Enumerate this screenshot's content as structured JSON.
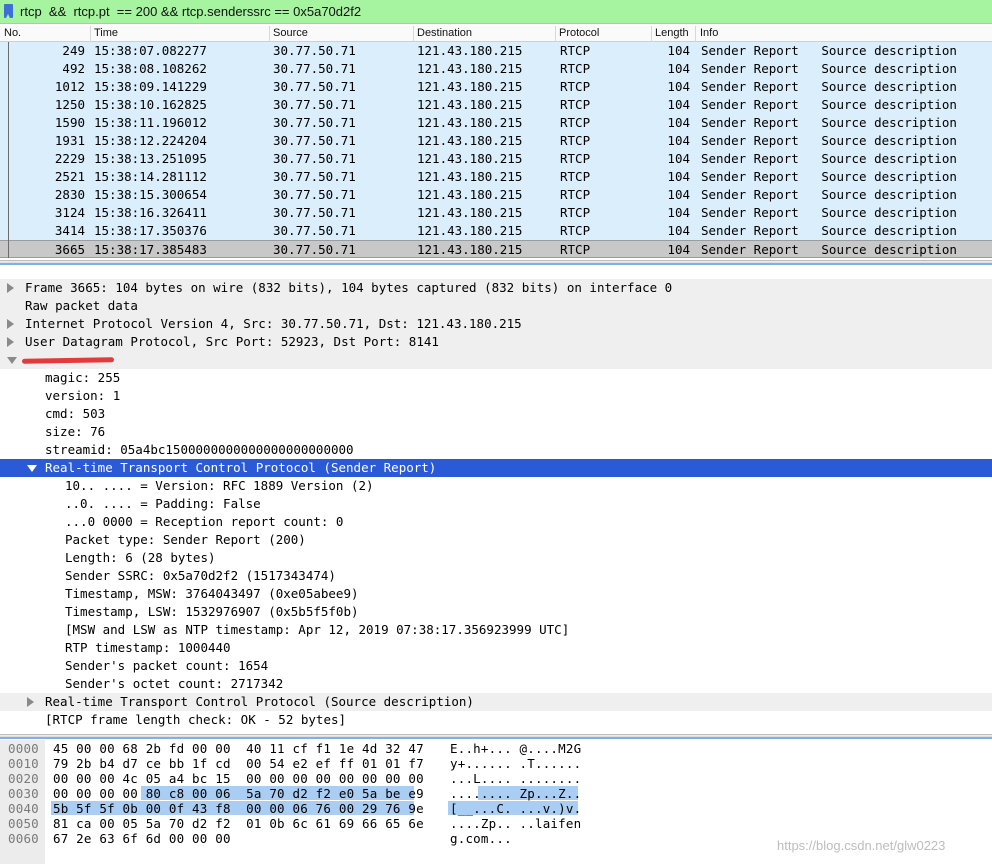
{
  "filter": {
    "value": "rtcp  &&  rtcp.pt  == 200 && rtcp.senderssrc == 0x5a70d2f2"
  },
  "packet_list": {
    "columns": [
      "No.",
      "Time",
      "Source",
      "Destination",
      "Protocol",
      "Length",
      "Info"
    ],
    "rows": [
      {
        "no": "249",
        "time": "15:38:07.082277",
        "src": "30.77.50.71",
        "dst": "121.43.180.215",
        "proto": "RTCP",
        "len": "104",
        "info": "Sender Report   Source description"
      },
      {
        "no": "492",
        "time": "15:38:08.108262",
        "src": "30.77.50.71",
        "dst": "121.43.180.215",
        "proto": "RTCP",
        "len": "104",
        "info": "Sender Report   Source description"
      },
      {
        "no": "1012",
        "time": "15:38:09.141229",
        "src": "30.77.50.71",
        "dst": "121.43.180.215",
        "proto": "RTCP",
        "len": "104",
        "info": "Sender Report   Source description"
      },
      {
        "no": "1250",
        "time": "15:38:10.162825",
        "src": "30.77.50.71",
        "dst": "121.43.180.215",
        "proto": "RTCP",
        "len": "104",
        "info": "Sender Report   Source description"
      },
      {
        "no": "1590",
        "time": "15:38:11.196012",
        "src": "30.77.50.71",
        "dst": "121.43.180.215",
        "proto": "RTCP",
        "len": "104",
        "info": "Sender Report   Source description"
      },
      {
        "no": "1931",
        "time": "15:38:12.224204",
        "src": "30.77.50.71",
        "dst": "121.43.180.215",
        "proto": "RTCP",
        "len": "104",
        "info": "Sender Report   Source description"
      },
      {
        "no": "2229",
        "time": "15:38:13.251095",
        "src": "30.77.50.71",
        "dst": "121.43.180.215",
        "proto": "RTCP",
        "len": "104",
        "info": "Sender Report   Source description"
      },
      {
        "no": "2521",
        "time": "15:38:14.281112",
        "src": "30.77.50.71",
        "dst": "121.43.180.215",
        "proto": "RTCP",
        "len": "104",
        "info": "Sender Report   Source description"
      },
      {
        "no": "2830",
        "time": "15:38:15.300654",
        "src": "30.77.50.71",
        "dst": "121.43.180.215",
        "proto": "RTCP",
        "len": "104",
        "info": "Sender Report   Source description"
      },
      {
        "no": "3124",
        "time": "15:38:16.326411",
        "src": "30.77.50.71",
        "dst": "121.43.180.215",
        "proto": "RTCP",
        "len": "104",
        "info": "Sender Report   Source description"
      },
      {
        "no": "3414",
        "time": "15:38:17.350376",
        "src": "30.77.50.71",
        "dst": "121.43.180.215",
        "proto": "RTCP",
        "len": "104",
        "info": "Sender Report   Source description"
      },
      {
        "no": "3665",
        "time": "15:38:17.385483",
        "src": "30.77.50.71",
        "dst": "121.43.180.215",
        "proto": "RTCP",
        "len": "104",
        "info": "Sender Report   Source description"
      }
    ],
    "selected_no": "3665"
  },
  "details": [
    {
      "text": "Frame 3665: 104 bytes on wire (832 bits), 104 bytes captured (832 bits) on interface 0",
      "level": 0,
      "arrow": "right",
      "band": true
    },
    {
      "text": "Raw packet data",
      "level": 0,
      "arrow": "none",
      "band": true
    },
    {
      "text": "Internet Protocol Version 4, Src: 30.77.50.71, Dst: 121.43.180.215",
      "level": 0,
      "arrow": "right",
      "band": true
    },
    {
      "text": "User Datagram Protocol, Src Port: 52923, Dst Port: 8141",
      "level": 0,
      "arrow": "right",
      "band": true
    },
    {
      "text": "",
      "level": 0,
      "arrow": "down",
      "band": true,
      "redacted": true
    },
    {
      "text": "magic: 255",
      "level": 1,
      "arrow": "none"
    },
    {
      "text": "version: 1",
      "level": 1,
      "arrow": "none"
    },
    {
      "text": "cmd: 503",
      "level": 1,
      "arrow": "none"
    },
    {
      "text": "size: 76",
      "level": 1,
      "arrow": "none"
    },
    {
      "text": "streamid: 05a4bc1500000000000000000000000",
      "level": 1,
      "arrow": "none"
    },
    {
      "text": "Real-time Transport Control Protocol (Sender Report)",
      "level": 1,
      "arrow": "down",
      "selected": true
    },
    {
      "text": "10.. .... = Version: RFC 1889 Version (2)",
      "level": 2,
      "arrow": "none"
    },
    {
      "text": "..0. .... = Padding: False",
      "level": 2,
      "arrow": "none"
    },
    {
      "text": "...0 0000 = Reception report count: 0",
      "level": 2,
      "arrow": "none"
    },
    {
      "text": "Packet type: Sender Report (200)",
      "level": 2,
      "arrow": "none"
    },
    {
      "text": "Length: 6 (28 bytes)",
      "level": 2,
      "arrow": "none"
    },
    {
      "text": "Sender SSRC: 0x5a70d2f2 (1517343474)",
      "level": 2,
      "arrow": "none"
    },
    {
      "text": "Timestamp, MSW: 3764043497 (0xe05abee9)",
      "level": 2,
      "arrow": "none"
    },
    {
      "text": "Timestamp, LSW: 1532976907 (0x5b5f5f0b)",
      "level": 2,
      "arrow": "none"
    },
    {
      "text": "[MSW and LSW as NTP timestamp: Apr 12, 2019 07:38:17.356923999 UTC]",
      "level": 2,
      "arrow": "none"
    },
    {
      "text": "RTP timestamp: 1000440",
      "level": 2,
      "arrow": "none"
    },
    {
      "text": "Sender's packet count: 1654",
      "level": 2,
      "arrow": "none"
    },
    {
      "text": "Sender's octet count: 2717342",
      "level": 2,
      "arrow": "none"
    },
    {
      "text": "Real-time Transport Control Protocol (Source description)",
      "level": 1,
      "arrow": "right",
      "band": true
    },
    {
      "text": "[RTCP frame length check: OK - 52 bytes]",
      "level": 1,
      "arrow": "none"
    }
  ],
  "hex": [
    {
      "offset": "0000",
      "bytes": "45 00 00 68 2b fd 00 00  40 11 cf f1 1e 4d 32 47",
      "ascii": "E..h+... @....M2G"
    },
    {
      "offset": "0010",
      "bytes": "79 2b b4 d7 ce bb 1f cd  00 54 e2 ef ff 01 01 f7",
      "ascii": "y+...... .T......"
    },
    {
      "offset": "0020",
      "bytes": "00 00 00 4c 05 a4 bc 15  00 00 00 00 00 00 00 00",
      "ascii": "...L.... ........"
    },
    {
      "offset": "0030",
      "bytes": "00 00 00 00 80 c8 00 06  5a 70 d2 f2 e0 5a be e9",
      "ascii": "........ Zp...Z.."
    },
    {
      "offset": "0040",
      "bytes": "5b 5f 5f 0b 00 0f 43 f8  00 00 06 76 00 29 76 9e",
      "ascii": "[__...C. ...v.)v."
    },
    {
      "offset": "0050",
      "bytes": "81 ca 00 05 5a 70 d2 f2  01 0b 6c 61 69 66 65 6e",
      "ascii": "....Zp.. ..laifen"
    },
    {
      "offset": "0060",
      "bytes": "67 2e 63 6f 6d 00 00 00",
      "ascii": "g.com..."
    }
  ],
  "watermark": "https://blog.csdn.net/glw0223",
  "colors": {
    "filter_bg": "#a6f3a0",
    "row_bg": "#daeefb",
    "selected_row_bg": "#c8c8c8",
    "tree_selected_bg": "#2a5ad7",
    "hex_highlight": "#a9cdf3"
  }
}
